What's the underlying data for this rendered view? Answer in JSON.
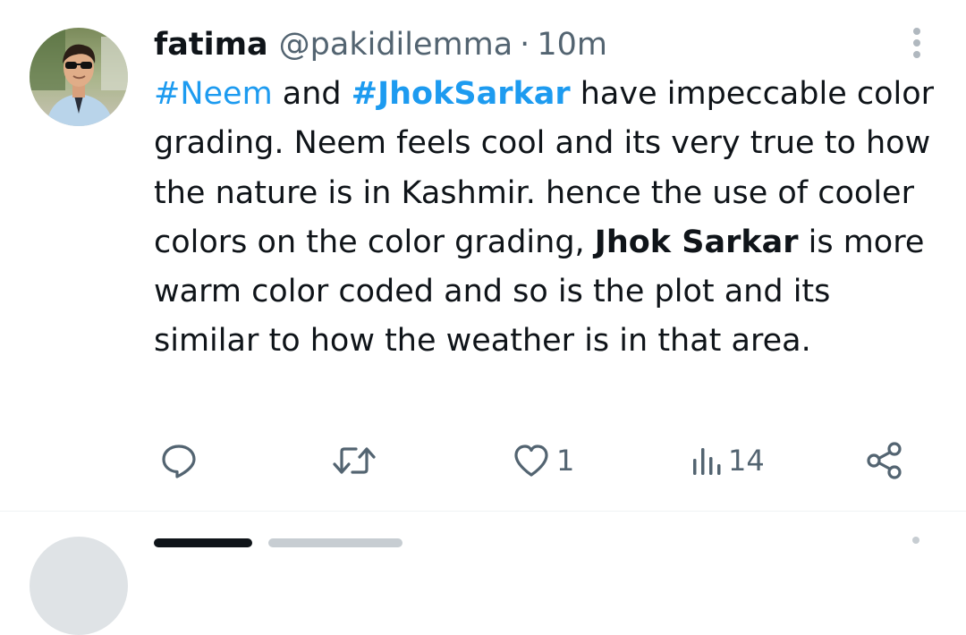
{
  "tweet": {
    "author": {
      "name": "fatima",
      "handle": "@pakidilemma",
      "separator": "·",
      "time": "10m"
    },
    "text": {
      "hashtag_1": "#Neem",
      "plain_1": " and ",
      "hashtag_2": "#JhokSarkar",
      "plain_2": " have impeccable color grading. Neem feels cool and its very true to how the nature is in Kashmir. hence the use of cooler colors on the color grading, ",
      "bold_1": "Jhok Sarkar",
      "plain_3": " is more warm color coded and so is the plot and its similar to how the weather is in that area."
    },
    "actions": {
      "reply": {
        "icon": "reply-icon",
        "count": ""
      },
      "retweet": {
        "icon": "retweet-icon",
        "count": ""
      },
      "like": {
        "icon": "heart-icon",
        "count": "1"
      },
      "views": {
        "icon": "views-icon",
        "count": "14"
      },
      "share": {
        "icon": "share-icon"
      }
    }
  },
  "colors": {
    "hashtag": "#1d9bf0",
    "text": "#0f1419",
    "secondary": "#536471",
    "divider": "#eff3f4"
  }
}
